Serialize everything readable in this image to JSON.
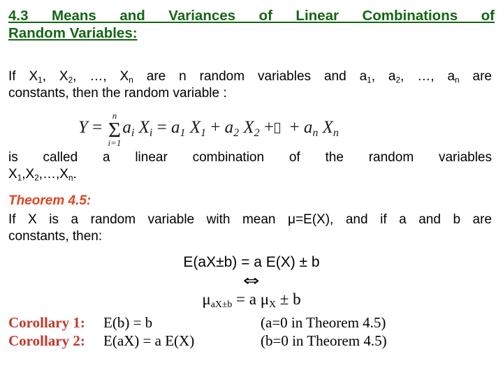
{
  "slide": {
    "title": {
      "line1": "4.3  Means  and  Variances  of  Linear  Combinations  of",
      "line2": "Random Variables:",
      "color": "#146614"
    },
    "intro": {
      "line1": "If X₁, X₂, …, Xₙ are n random variables and a₁, a₂, …, aₙ are",
      "line1_parts": {
        "seg_if": "If X",
        "sub_1": "1",
        "seg_comma1": ", X",
        "sub_2": "2",
        "seg_dots": ", …, X",
        "sub_n": "n",
        "seg_mid": " are n random variables and a",
        "sub_a1": "1",
        "seg_a2": ", a",
        "sub_a2": "2",
        "seg_an": ", …, a",
        "sub_an": "n",
        "seg_end": " are"
      },
      "line2": "constants, then the random variable :"
    },
    "formula": {
      "lhs": "Y",
      "equals": "=",
      "sum_upper": "n",
      "sum_symbol": "Σ",
      "sum_lower": "i=1",
      "term_generic_a": "a",
      "term_generic_a_sub": "i",
      "term_generic_X": "X",
      "term_generic_X_sub": "i",
      "equals2": "=",
      "t1_a": "a",
      "t1_a_sub": "1",
      "t1_X": "X",
      "t1_X_sub": "1",
      "plus1": "+",
      "t2_a": "a",
      "t2_a_sub": "2",
      "t2_X": "X",
      "t2_X_sub": "2",
      "plus2": "+",
      "missing_glyph": "□",
      "plus3": "+",
      "tn_a": "a",
      "tn_a_sub": "n",
      "tn_X": "X",
      "tn_X_sub": "n"
    },
    "definition": {
      "line1": "is called a linear combination of the random variables",
      "line2_parts": {
        "seg_X1": "X",
        "sub_1": "1",
        "seg_X2": ",X",
        "sub_2": "2",
        "seg_dots": ",…,X",
        "sub_n": "n",
        "seg_period": "."
      }
    },
    "theorem": {
      "heading": "Theorem 4.5:",
      "heading_color": "#dd4620",
      "line1": "If X is a random variable with mean μ=E(X), and if a and b are",
      "line2": "constants, then:"
    },
    "equations": {
      "eq1": "E(aX±b) = a E(X) ± b",
      "arrow": "⇔",
      "eq2_parts": {
        "mu1": "μ",
        "mu1_sub": "aX±b",
        "equals": " = a ",
        "mu2": "μ",
        "mu2_sub": "X",
        "tail": " ± b"
      }
    },
    "corollaries": [
      {
        "label": "Corollary 1:",
        "equation": "E(b) =  b",
        "note": "(a=0 in Theorem 4.5)"
      },
      {
        "label": "Corollary 2:",
        "equation": "E(aX) = a E(X)",
        "note": "(b=0 in Theorem 4.5)"
      }
    ],
    "colors": {
      "title_green": "#146614",
      "theorem_orange": "#dd4620",
      "corollary_red": "#c0392b",
      "body_black": "#000000",
      "background": "#ffffff"
    }
  }
}
